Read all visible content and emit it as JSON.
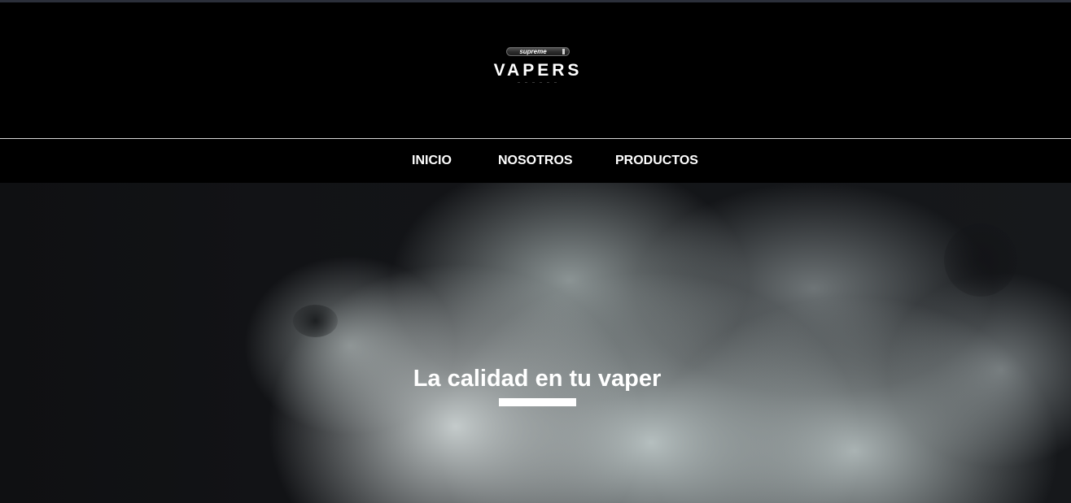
{
  "brand": {
    "logo_top": "supreme",
    "logo_word": "VAPERS"
  },
  "nav": {
    "items": [
      {
        "label": "INICIO"
      },
      {
        "label": "NOSOTROS"
      },
      {
        "label": "PRODUCTOS"
      }
    ]
  },
  "hero": {
    "title": "La calidad en tu vaper"
  },
  "colors": {
    "background": "#000000",
    "nav_text": "#ffffff",
    "accent_underline": "#ffffff",
    "smoke": "#c8d0d0"
  }
}
